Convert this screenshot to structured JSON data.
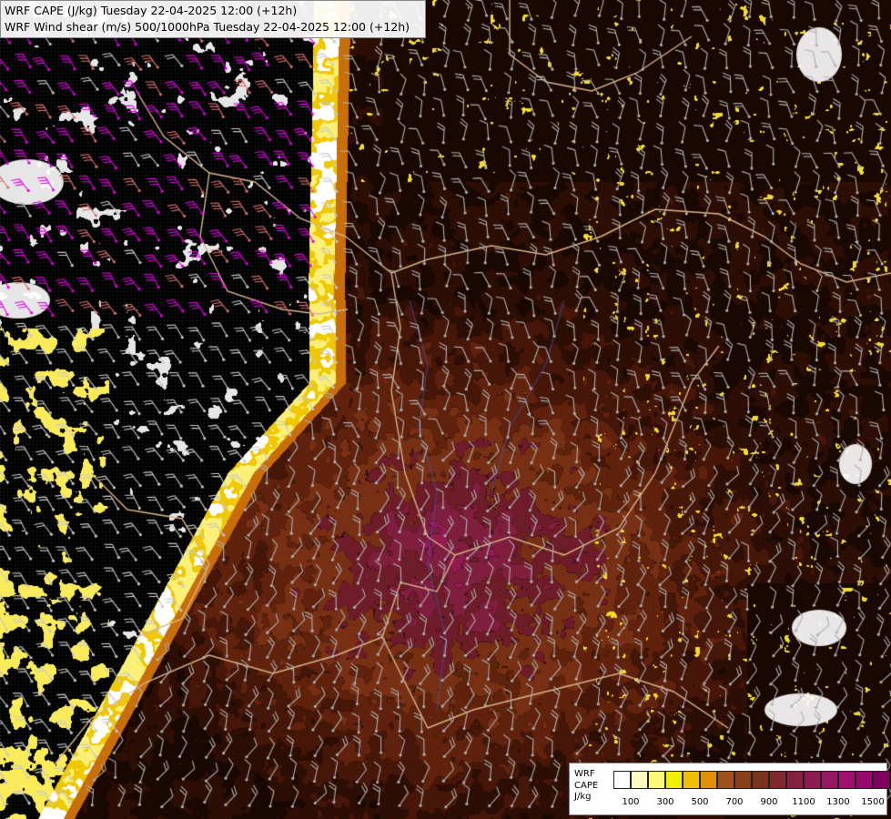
{
  "map": {
    "title_line_1": "WRF CAPE (J/kg) Tuesday 22-04-2025 12:00 (+12h)",
    "title_line_2": "WRF Wind shear (m/s) 500/1000hPa Tuesday 22-04-2025 12:00 (+12h)"
  },
  "legend": {
    "label_line_1": "WRF",
    "label_line_2": "CAPE",
    "label_line_3": "J/kg",
    "colors": [
      "#ffffff",
      "#fcfcc0",
      "#fafa78",
      "#f0f000",
      "#f0c000",
      "#e09000",
      "#a0501a",
      "#8a3e1c",
      "#7a331e",
      "#80282e",
      "#862040",
      "#8c1c50",
      "#961860",
      "#a0106e",
      "#960a6e",
      "#800060"
    ],
    "ticks": [
      "100",
      "300",
      "500",
      "700",
      "900",
      "1100",
      "1300",
      "1500"
    ]
  },
  "palette": {
    "barb_west": "#e000e0",
    "barb_east": "#b0b0b0",
    "border": "#d8b48a"
  }
}
